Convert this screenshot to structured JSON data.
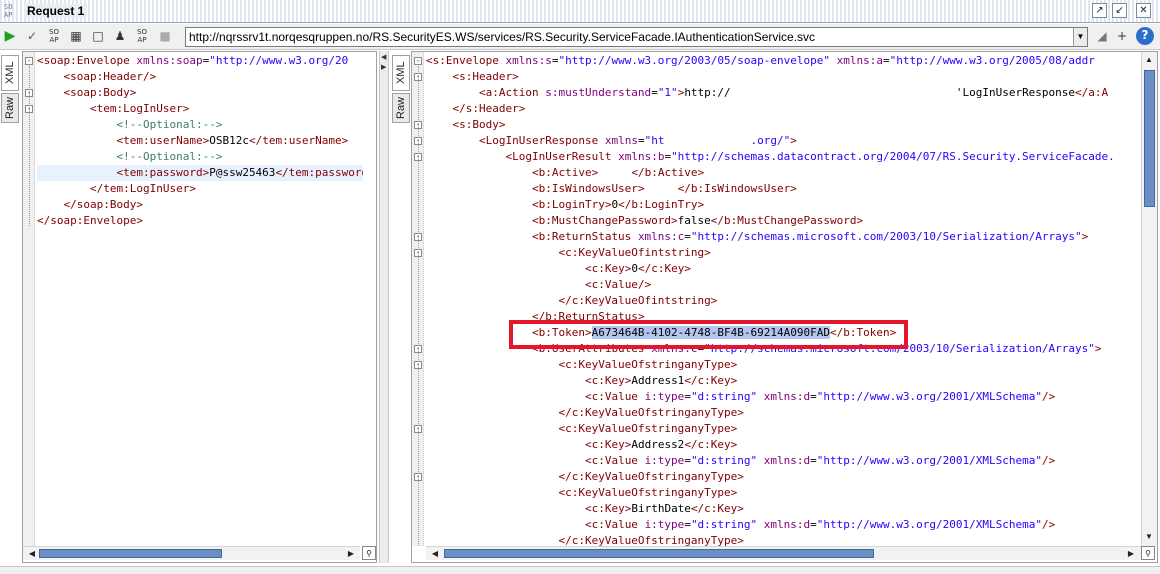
{
  "window": {
    "title": "Request 1",
    "logo_text": "SO AP"
  },
  "toolbar": {
    "url": "http://nqrssrv1t.norqesqruppen.no/RS.SecurityES.WS/services/RS.Security.ServiceFacade.IAuthenticationService.svc",
    "icons": [
      "play-icon",
      "submit-check-icon",
      "soap-icon",
      "grid-icon",
      "stop-icon",
      "user-icon",
      "soap-icon-2",
      "gray-square-icon",
      "filter-icon",
      "add-icon",
      "help-icon"
    ]
  },
  "tabs": {
    "xml": "XML",
    "raw": "Raw"
  },
  "request": {
    "lines": [
      "<soap:Envelope xmlns:soap=\"http://www.w3.org/20",
      "    <soap:Header/>",
      "    <soap:Body>",
      "        <tem:LogInUser>",
      "            <!--Optional:-->",
      "            <tem:userName>OSB12c</tem:userName>",
      "            <!--Optional:-->",
      "            <tem:password>P@ssw25463</tem:password",
      "        </tem:LogInUser>",
      "    </soap:Body>",
      "</soap:Envelope>"
    ]
  },
  "response": {
    "lines": [
      "<s:Envelope xmlns:s=\"http://www.w3.org/2003/05/soap-envelope\" xmlns:a=\"http://www.w3.org/2005/08/addr",
      "    <s:Header>",
      "        <a:Action s:mustUnderstand=\"1\">http://                                  'LogInUserResponse</a:A",
      "    </s:Header>",
      "    <s:Body>",
      "        <LogInUserResponse xmlns=\"ht             .org/\">",
      "            <LogInUserResult xmlns:b=\"http://schemas.datacontract.org/2004/07/RS.Security.ServiceFacade.",
      "                <b:Active>     </b:Active>",
      "                <b:IsWindowsUser>     </b:IsWindowsUser>",
      "                <b:LoginTry>0</b:LoginTry>",
      "                <b:MustChangePassword>false</b:MustChangePassword>",
      "                <b:ReturnStatus xmlns:c=\"http://schemas.microsoft.com/2003/10/Serialization/Arrays\">",
      "                    <c:KeyValueOfintstring>",
      "                        <c:Key>0</c:Key>",
      "                        <c:Value/>",
      "                    </c:KeyValueOfintstring>",
      "                </b:ReturnStatus>",
      "                <b:Token>A673464B-4102-4748-BF4B-69214A090FAD</b:Token>",
      "                <b:UserAttributes xmlns:c=\"http://schemas.microsoft.com/2003/10/Serialization/Arrays\">",
      "                    <c:KeyValueOfstringanyType>",
      "                        <c:Key>Address1</c:Key>",
      "                        <c:Value i:type=\"d:string\" xmlns:d=\"http://www.w3.org/2001/XMLSchema\"/>",
      "                    </c:KeyValueOfstringanyType>",
      "                    <c:KeyValueOfstringanyType>",
      "                        <c:Key>Address2</c:Key>",
      "                        <c:Value i:type=\"d:string\" xmlns:d=\"http://www.w3.org/2001/XMLSchema\"/>",
      "                    </c:KeyValueOfstringanyType>",
      "                    <c:KeyValueOfstringanyType>",
      "                        <c:Key>BirthDate</c:Key>",
      "                        <c:Value i:type=\"d:string\" xmlns:d=\"http://www.w3.org/2001/XMLSchema\"/>",
      "                    </c:KeyValueOfstringanyType>"
    ],
    "token": "A673464B-4102-4748-BF4B-69214A090FAD"
  },
  "colors": {
    "highlight_box": "#e3162b",
    "selection": "#b3c6ef",
    "scroll_thumb": "#6a8fc7"
  }
}
